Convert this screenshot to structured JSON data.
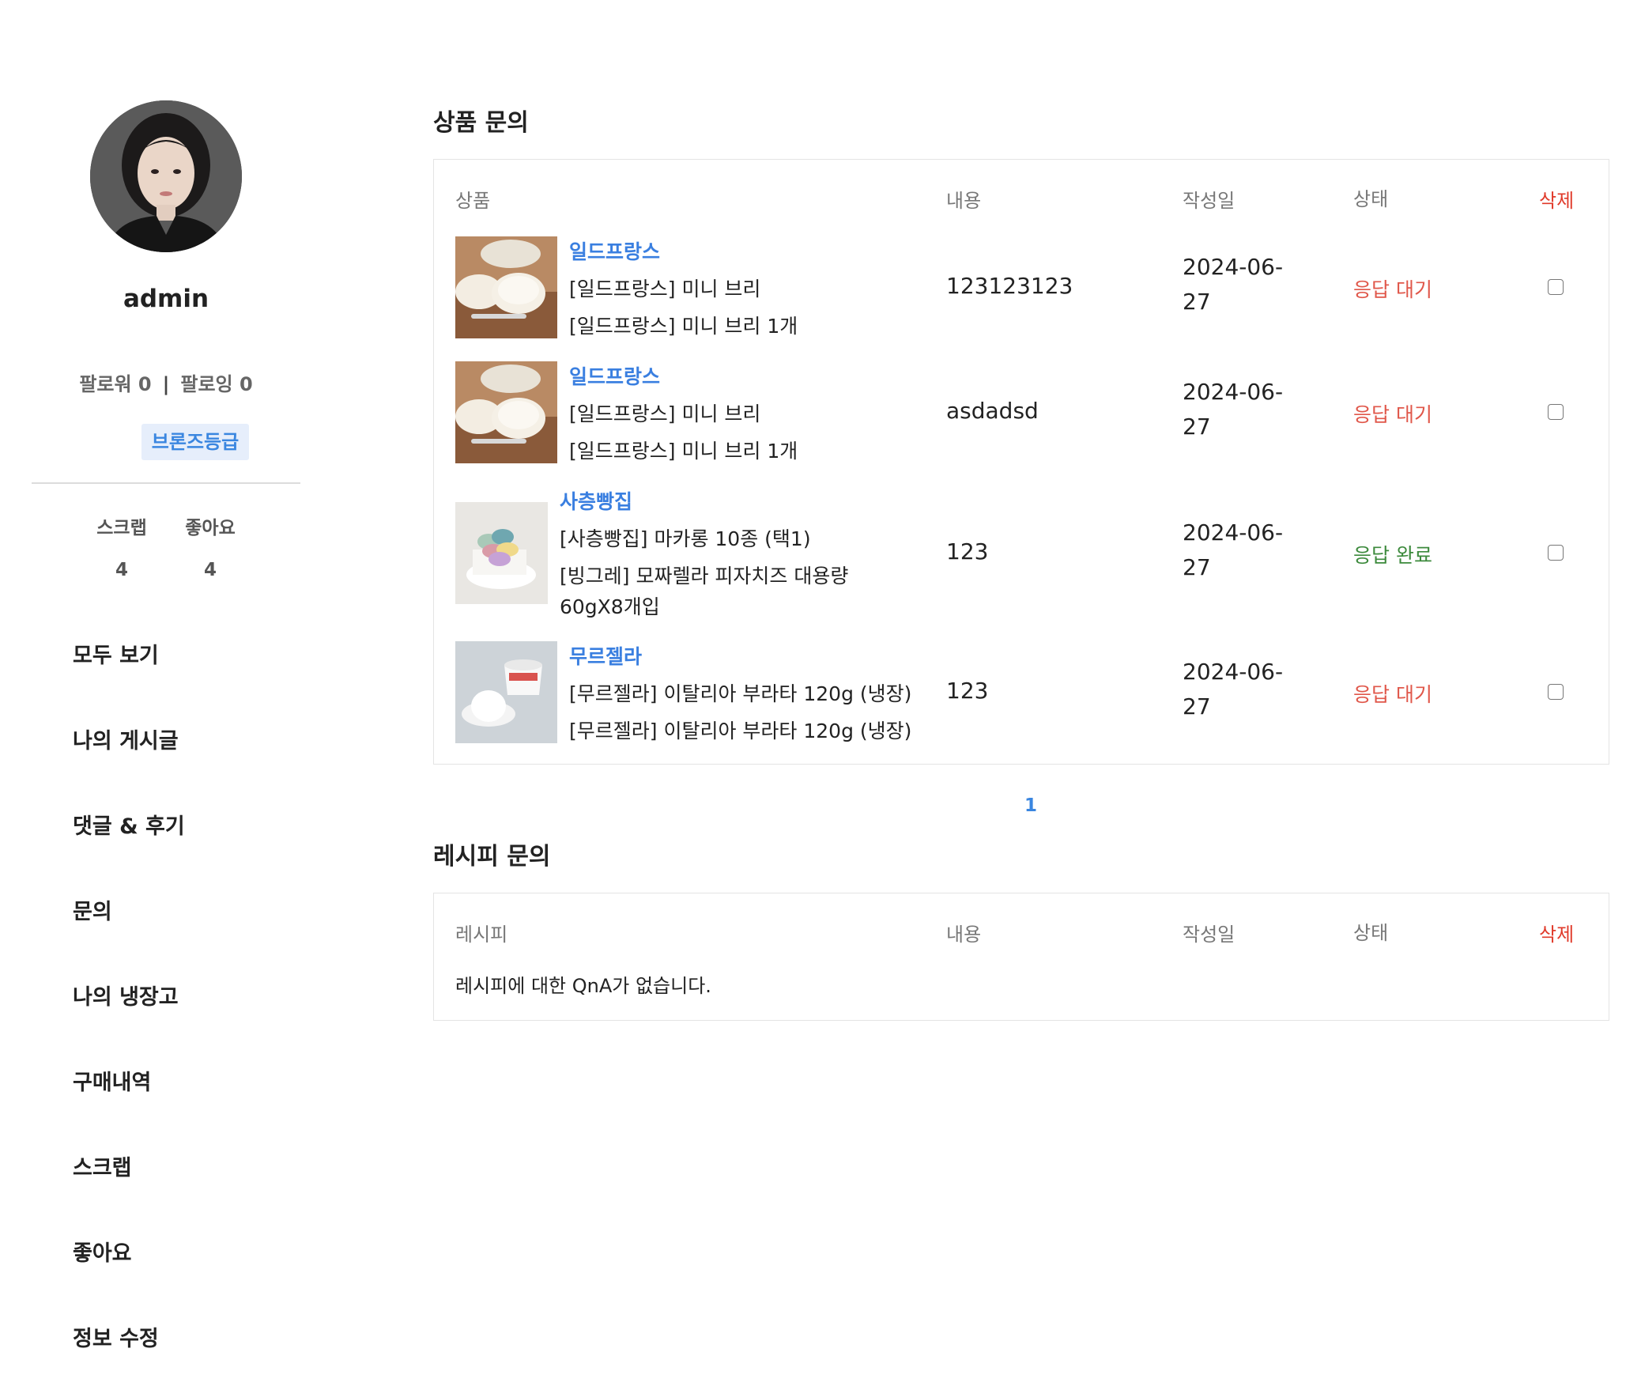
{
  "profile": {
    "username": "admin",
    "followers_label": "팔로워 0",
    "following_label": "팔로잉 0",
    "separator": "|",
    "grade": "브론즈등급",
    "stats": [
      {
        "label": "스크랩",
        "value": "4"
      },
      {
        "label": "좋아요",
        "value": "4"
      }
    ]
  },
  "menu": [
    {
      "label": "모두 보기"
    },
    {
      "label": "나의 게시글"
    },
    {
      "label": "댓글 & 후기"
    },
    {
      "label": "문의"
    },
    {
      "label": "나의 냉장고"
    },
    {
      "label": "구매내역"
    },
    {
      "label": "스크랩"
    },
    {
      "label": "좋아요"
    },
    {
      "label": "정보 수정"
    }
  ],
  "product_qna": {
    "title": "상품 문의",
    "columns": {
      "item": "상품",
      "content": "내용",
      "date": "작성일",
      "status": "상태",
      "delete": "삭제"
    },
    "rows": [
      {
        "brand": "일드프랑스",
        "lines": [
          "[일드프랑스] 미니 브리",
          "[일드프랑스] 미니 브리 1개"
        ],
        "content": "123123123",
        "date_line1": "2024-06-",
        "date_line2": "27",
        "status": "응답 대기",
        "status_type": "wait",
        "thumb": "brie-cheese-image"
      },
      {
        "brand": "일드프랑스",
        "lines": [
          "[일드프랑스] 미니 브리",
          "[일드프랑스] 미니 브리 1개"
        ],
        "content": "asdadsd",
        "date_line1": "2024-06-",
        "date_line2": "27",
        "status": "응답 대기",
        "status_type": "wait",
        "thumb": "brie-cheese-image"
      },
      {
        "brand": "사층빵집",
        "lines": [
          "[사층빵집] 마카롱 10종 (택1)",
          "[빙그레] 모짜렐라 피자치즈 대용량",
          "60gX8개입"
        ],
        "content": "123",
        "date_line1": "2024-06-",
        "date_line2": "27",
        "status": "응답 완료",
        "status_type": "done",
        "thumb": "macaron-image"
      },
      {
        "brand": "무르젤라",
        "lines": [
          "[무르젤라] 이탈리아 부라타 120g (냉장)",
          "[무르젤라] 이탈리아 부라타 120g (냉장)"
        ],
        "content": "123",
        "date_line1": "2024-06-",
        "date_line2": "27",
        "status": "응답 대기",
        "status_type": "wait",
        "thumb": "burrata-image"
      }
    ],
    "pagination": {
      "current": "1"
    }
  },
  "recipe_qna": {
    "title": "레시피 문의",
    "columns": {
      "item": "레시피",
      "content": "내용",
      "date": "작성일",
      "status": "상태",
      "delete": "삭제"
    },
    "empty_message": "레시피에 대한 QnA가 없습니다."
  },
  "colors": {
    "accent_blue": "#3a86e0",
    "status_wait": "#e0574a",
    "status_done": "#3c8a3c",
    "delete_red": "#e03a2a"
  }
}
